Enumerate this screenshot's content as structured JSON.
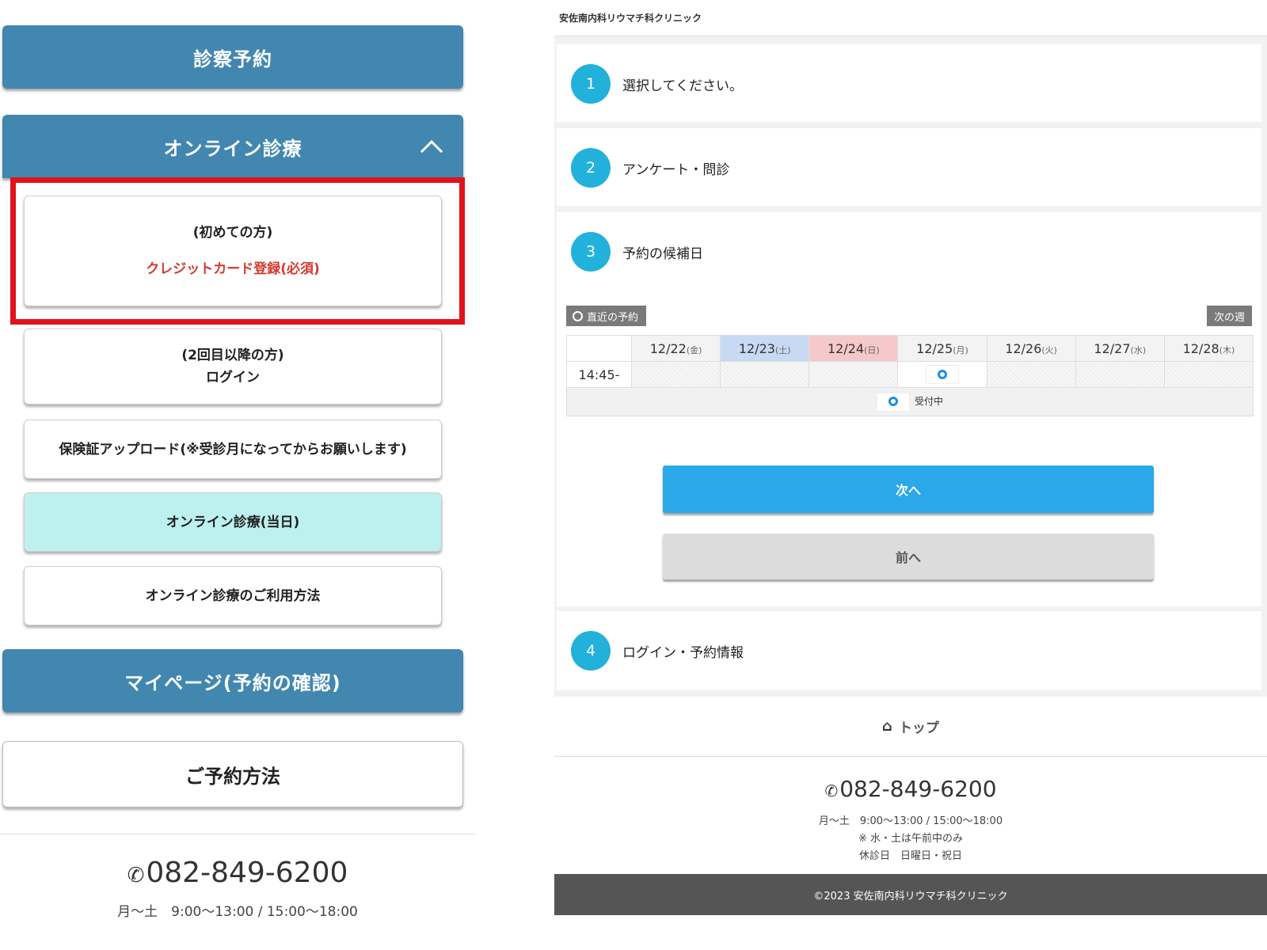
{
  "left": {
    "reserve_label": "診察予約",
    "online_label": "オンライン診療",
    "first_visit_line1": "(初めての方)",
    "first_visit_line2": "クレジットカード登録(必須)",
    "second_visit_line1": "(2回目以降の方)",
    "second_visit_line2": "ログイン",
    "upload_label": "保険証アップロード(※受診月になってからお願いします)",
    "today_label": "オンライン診療(当日)",
    "howto_label": "オンライン診療のご利用方法",
    "mypage_label": "マイページ(予約の確認)",
    "how_reserve_label": "ご予約方法",
    "phone": "082-849-6200",
    "hours": "月〜土　9:00〜13:00 / 15:00〜18:00"
  },
  "right": {
    "clinic_name": "安佐南内科リウマチ科クリニック",
    "steps": [
      {
        "num": "1",
        "label": "選択してください。"
      },
      {
        "num": "2",
        "label": "アンケート・問診"
      },
      {
        "num": "3",
        "label": "予約の候補日"
      },
      {
        "num": "4",
        "label": "ログイン・予約情報"
      }
    ],
    "recent_label": "直近の予約",
    "next_week_label": "次の週",
    "calendar": {
      "dates": [
        {
          "date": "12/22",
          "dow": "(金)"
        },
        {
          "date": "12/23",
          "dow": "(土)"
        },
        {
          "date": "12/24",
          "dow": "(日)"
        },
        {
          "date": "12/25",
          "dow": "(月)"
        },
        {
          "date": "12/26",
          "dow": "(火)"
        },
        {
          "date": "12/27",
          "dow": "(水)"
        },
        {
          "date": "12/28",
          "dow": "(木)"
        }
      ],
      "time_slot": "14:45-",
      "legend_label": "受付中"
    },
    "next_label": "次へ",
    "prev_label": "前へ",
    "top_label": "トップ",
    "phone": "082-849-6200",
    "hours": "月〜土　9:00〜13:00 / 15:00〜18:00",
    "note": "※ 水・土は午前中のみ",
    "closed": "休診日　日曜日・祝日",
    "copyright": "©2023 安佐南内科リウマチ科クリニック"
  }
}
